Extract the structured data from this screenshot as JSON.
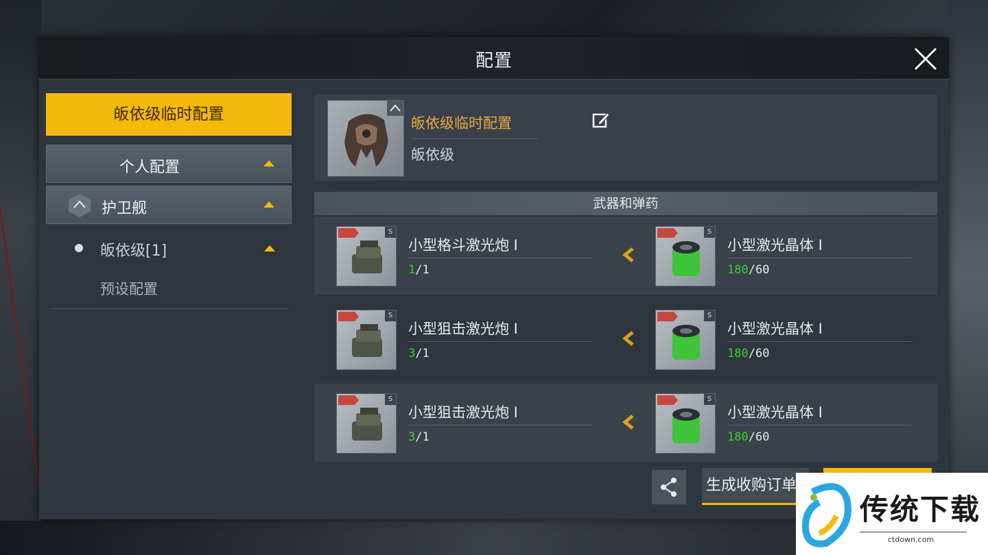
{
  "dialog": {
    "title": "配置"
  },
  "sidebar": {
    "active_tab": "皈依级临时配置",
    "personal": "个人配置",
    "category": "护卫舰",
    "ship_entry": "皈依级[1]",
    "preset": "预设配置"
  },
  "ship": {
    "name": "皈依级临时配置",
    "class": "皈依级"
  },
  "weapons": {
    "section_title": "武器和弹药",
    "rows": [
      {
        "weapon": {
          "name": "小型格斗激光炮 I",
          "count_have": "1",
          "count_total": "/1",
          "size": "S"
        },
        "ammo": {
          "name": "小型激光晶体 I",
          "count_have": "180",
          "count_total": "/60",
          "size": "S"
        }
      },
      {
        "weapon": {
          "name": "小型狙击激光炮 I",
          "count_have": "3",
          "count_total": "/1",
          "size": "S"
        },
        "ammo": {
          "name": "小型激光晶体 I",
          "count_have": "180",
          "count_total": "/60",
          "size": "S"
        }
      },
      {
        "weapon": {
          "name": "小型狙击激光炮 I",
          "count_have": "3",
          "count_total": "/1",
          "size": "S"
        },
        "ammo": {
          "name": "小型激光晶体 I",
          "count_have": "180",
          "count_total": "/60",
          "size": "S"
        }
      }
    ]
  },
  "footer": {
    "order_button": "生成收购订单"
  },
  "watermark": {
    "text": "传统下载",
    "url": "ctdown.com"
  },
  "colors": {
    "accent": "#f5b80c",
    "ship_name": "#e8a93a",
    "count_green": "#3ccf36"
  },
  "icons": [
    "close-icon",
    "edit-icon",
    "share-icon",
    "chevron-left-icon",
    "arrow-up-icon",
    "hexagon-icon"
  ]
}
